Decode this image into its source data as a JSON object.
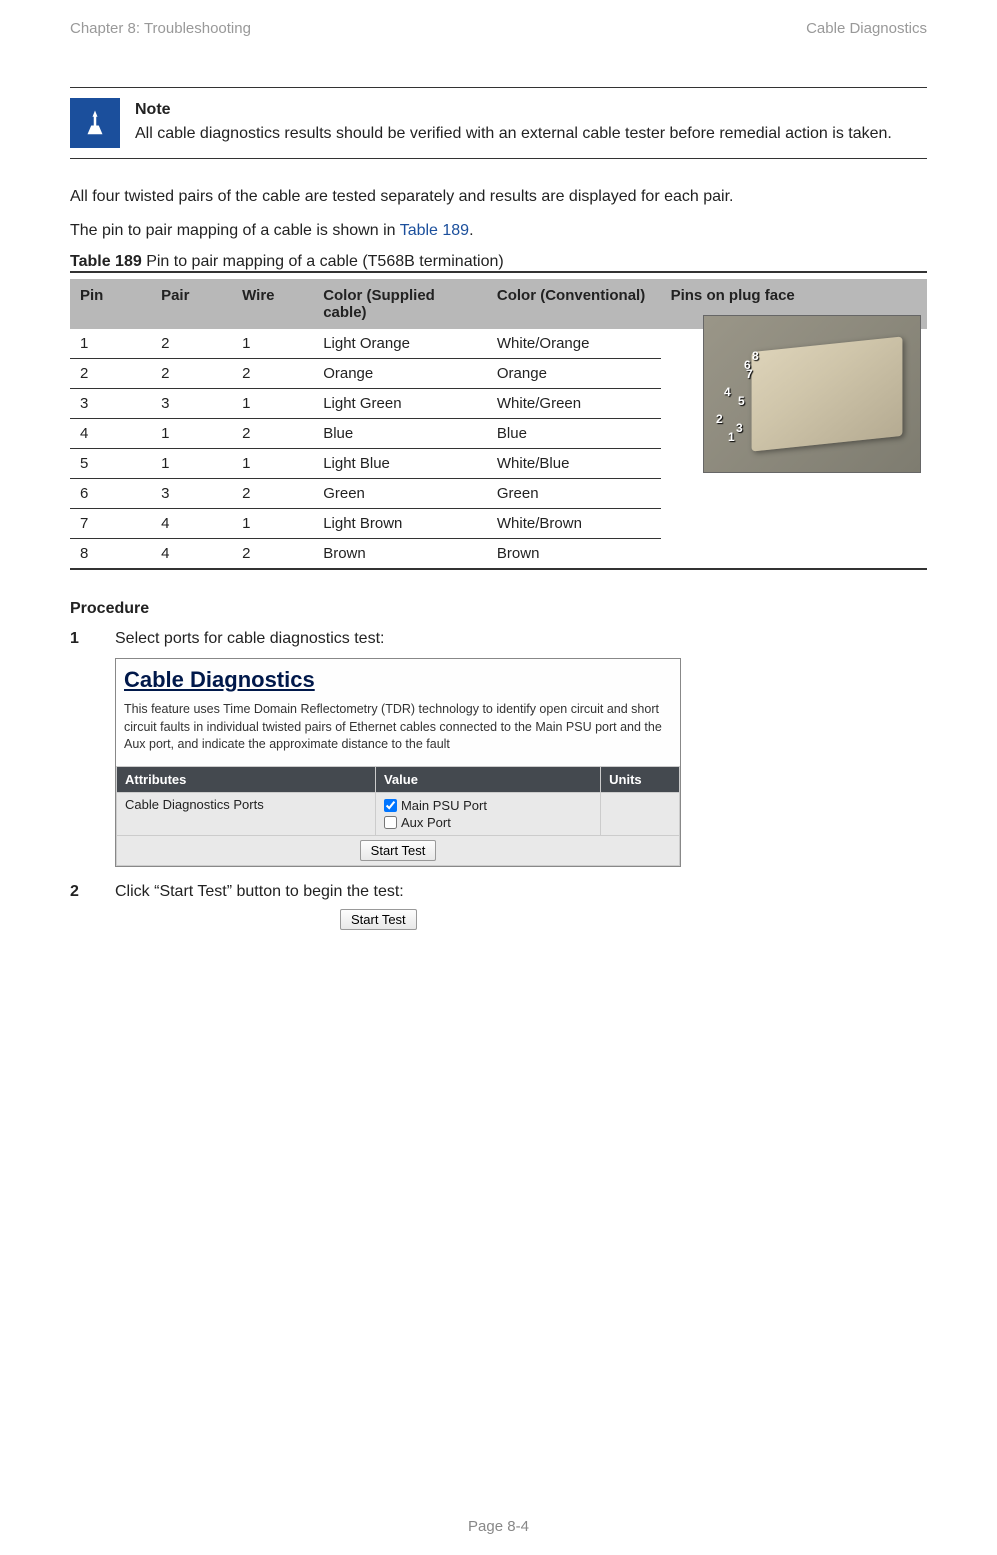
{
  "header": {
    "left": "Chapter 8:  Troubleshooting",
    "right": "Cable Diagnostics"
  },
  "note": {
    "title": "Note",
    "body": "All cable diagnostics results should be verified with an external cable tester before remedial action is taken."
  },
  "intro": {
    "p1": "All four twisted pairs of the cable are tested separately and results are displayed for each pair.",
    "p2_pre": "The pin to pair mapping of a cable is shown in ",
    "p2_link": "Table 189",
    "p2_post": "."
  },
  "table": {
    "label": "Table 189",
    "caption": "  Pin to pair mapping of a cable (T568B termination)",
    "headers": {
      "pin": "Pin",
      "pair": "Pair",
      "wire": "Wire",
      "color_supplied": "Color (Supplied cable)",
      "color_conv": "Color (Conventional)",
      "plug": "Pins on plug face"
    },
    "rows": [
      {
        "pin": "1",
        "pair": "2",
        "wire": "1",
        "cs": "Light Orange",
        "cc": "White/Orange"
      },
      {
        "pin": "2",
        "pair": "2",
        "wire": "2",
        "cs": "Orange",
        "cc": "Orange"
      },
      {
        "pin": "3",
        "pair": "3",
        "wire": "1",
        "cs": "Light Green",
        "cc": "White/Green"
      },
      {
        "pin": "4",
        "pair": "1",
        "wire": "2",
        "cs": "Blue",
        "cc": "Blue"
      },
      {
        "pin": "5",
        "pair": "1",
        "wire": "1",
        "cs": "Light Blue",
        "cc": "White/Blue"
      },
      {
        "pin": "6",
        "pair": "3",
        "wire": "2",
        "cs": "Green",
        "cc": "Green"
      },
      {
        "pin": "7",
        "pair": "4",
        "wire": "1",
        "cs": "Light Brown",
        "cc": "White/Brown"
      },
      {
        "pin": "8",
        "pair": "4",
        "wire": "2",
        "cs": "Brown",
        "cc": "Brown"
      }
    ],
    "pin_overlay": [
      "8",
      "6",
      "4",
      "2",
      "7",
      "5",
      "3",
      "1"
    ]
  },
  "procedure": {
    "title": "Procedure",
    "step1": {
      "num": "1",
      "text": "Select ports for cable diagnostics test:"
    },
    "step2": {
      "num": "2",
      "text": "Click “Start Test” button to begin the test:"
    }
  },
  "ui": {
    "title": "Cable Diagnostics",
    "desc": "This feature uses Time Domain Reflectometry (TDR) technology to identify open circuit and short circuit faults in individual twisted pairs of Ethernet cables connected to the Main PSU port and the Aux port, and indicate the approximate distance to the fault",
    "th_attr": "Attributes",
    "th_val": "Value",
    "th_units": "Units",
    "row_label": "Cable Diagnostics Ports",
    "port1": "Main PSU Port",
    "port2": "Aux Port",
    "button": "Start Test"
  },
  "footer": "Page 8-4"
}
